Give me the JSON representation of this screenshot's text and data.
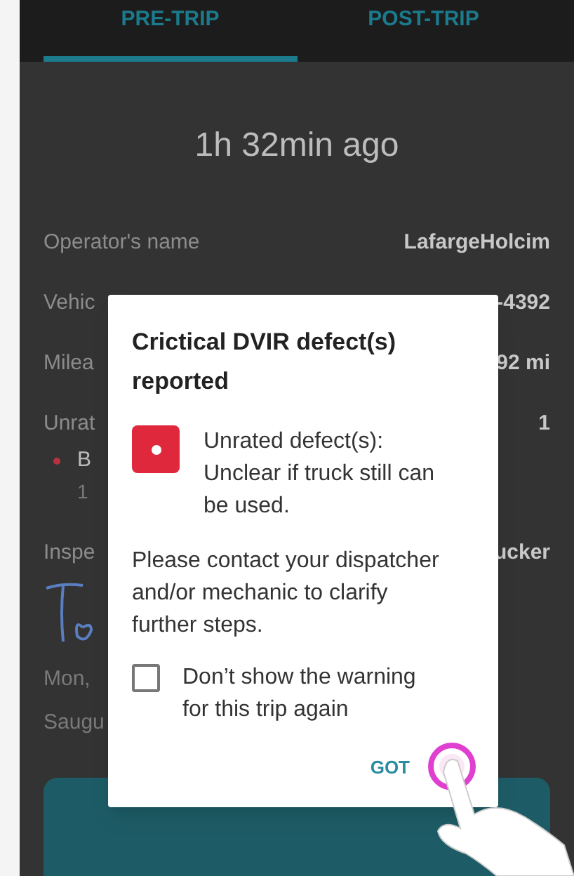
{
  "tabs": [
    {
      "label": "PRE-TRIP",
      "selected": true
    },
    {
      "label": "POST-TRIP",
      "selected": false
    }
  ],
  "time_ago": "1h 32min ago",
  "rows": [
    {
      "label": "Operator's name",
      "value": "LafargeHolcim"
    },
    {
      "label": "Vehic",
      "value": "-4392"
    },
    {
      "label": "Milea",
      "value": "92 mi"
    },
    {
      "label": "Unrat",
      "value": "1"
    }
  ],
  "defect": {
    "name": "B",
    "detail": "1"
  },
  "inspector": {
    "label": "Inspe",
    "value": "ucker"
  },
  "footer_lines": [
    "Mon,",
    "Saugu"
  ],
  "dialog": {
    "title": "Crictical DVIR defect(s) reported",
    "severity": {
      "text": "Unrated defect(s): Unclear if truck still can be used.",
      "color": "#e0283c"
    },
    "message": "Please contact your dispatcher and/or mechanic to clarify further steps.",
    "checkbox": {
      "label": "Don’t show the warning for this trip again",
      "checked": false
    },
    "button": "GOT"
  }
}
